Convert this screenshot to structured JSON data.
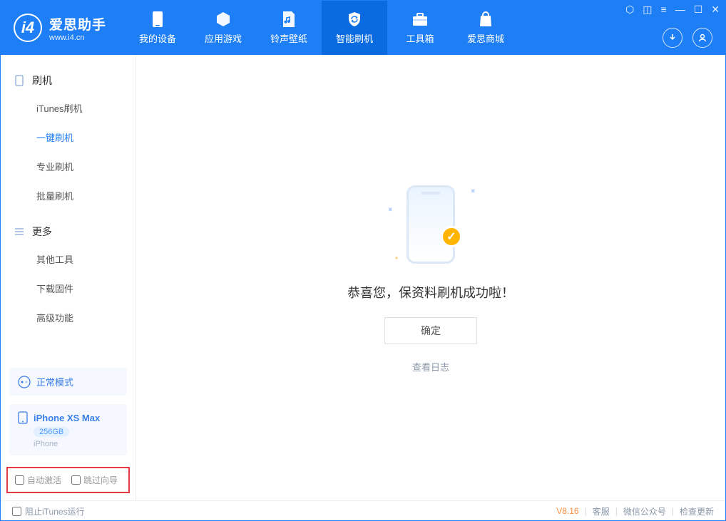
{
  "brand": {
    "title": "爱思助手",
    "subtitle": "www.i4.cn"
  },
  "header_tabs": [
    {
      "label": "我的设备"
    },
    {
      "label": "应用游戏"
    },
    {
      "label": "铃声壁纸"
    },
    {
      "label": "智能刷机"
    },
    {
      "label": "工具箱"
    },
    {
      "label": "爱思商城"
    }
  ],
  "sidebar": {
    "flash": {
      "title": "刷机",
      "items": [
        "iTunes刷机",
        "一键刷机",
        "专业刷机",
        "批量刷机"
      ]
    },
    "more": {
      "title": "更多",
      "items": [
        "其他工具",
        "下载固件",
        "高级功能"
      ]
    }
  },
  "mode_card": {
    "label": "正常模式"
  },
  "device_card": {
    "name": "iPhone XS Max",
    "storage": "256GB",
    "type": "iPhone"
  },
  "options": {
    "auto_activate": "自动激活",
    "skip_guide": "跳过向导"
  },
  "main": {
    "message": "恭喜您，保资料刷机成功啦！",
    "ok": "确定",
    "view_log": "查看日志"
  },
  "footer": {
    "block_itunes": "阻止iTunes运行",
    "version": "V8.16",
    "support": "客服",
    "wechat": "微信公众号",
    "update": "检查更新"
  }
}
